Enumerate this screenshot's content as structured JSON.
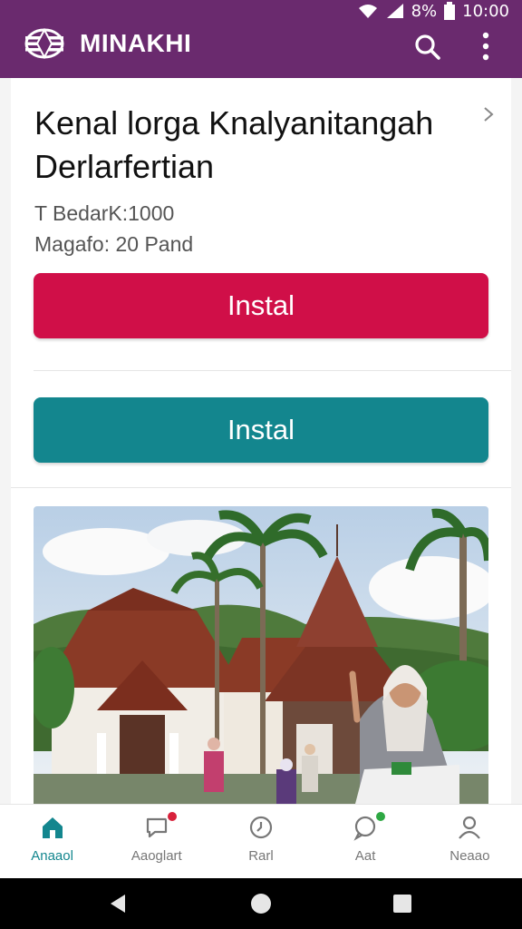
{
  "status": {
    "battery_text": "8%",
    "time": "10:00"
  },
  "app": {
    "brand": "MINAKHI"
  },
  "card": {
    "title": "Kenal lorga Knalyanitangah Derlarfertian",
    "meta_line1": "T BedarK:1000",
    "meta_line2": "Magafo: 20 Pand",
    "primary_button": "Instal",
    "secondary_button": "Instal"
  },
  "bottom_nav": {
    "items": [
      {
        "label": "Anaaol",
        "icon": "home-icon"
      },
      {
        "label": "Aaoglart",
        "icon": "chat-icon"
      },
      {
        "label": "Rarl",
        "icon": "clock-icon"
      },
      {
        "label": "Aat",
        "icon": "message-icon"
      },
      {
        "label": "Neaao",
        "icon": "profile-icon"
      }
    ],
    "active_index": 0
  },
  "colors": {
    "app_bar": "#6a2a6e",
    "primary_button": "#d00f48",
    "secondary_button": "#13868e",
    "active_nav": "#13868e",
    "badge_red": "#d8213b",
    "badge_green": "#2ea843"
  }
}
